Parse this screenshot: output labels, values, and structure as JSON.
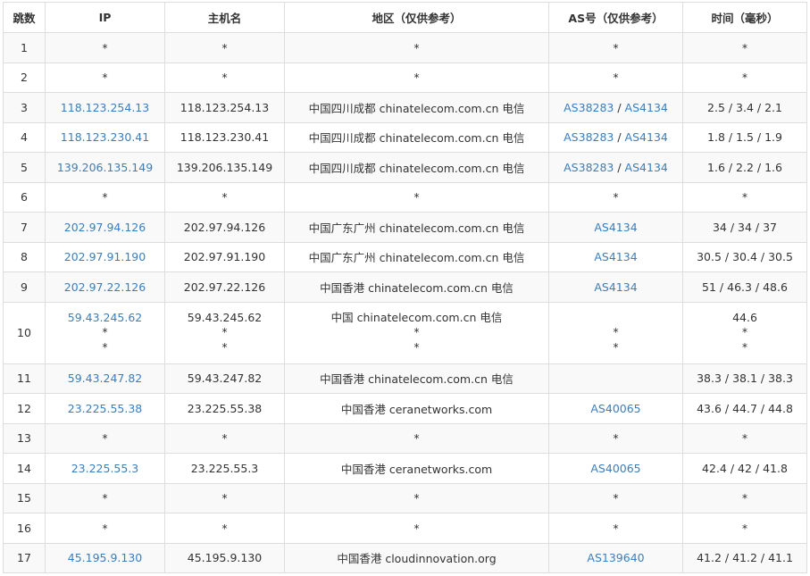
{
  "headers": [
    "跳数",
    "IP",
    "主机名",
    "地区（仅供参考）",
    "AS号（仅供参考）",
    "时间（毫秒）"
  ],
  "rows": [
    {
      "hop": "1",
      "ip": [
        "*"
      ],
      "host": [
        "*"
      ],
      "region": [
        "*"
      ],
      "as": [
        [
          "*"
        ]
      ],
      "time": [
        "*"
      ]
    },
    {
      "hop": "2",
      "ip": [
        "*"
      ],
      "host": [
        "*"
      ],
      "region": [
        "*"
      ],
      "as": [
        [
          "*"
        ]
      ],
      "time": [
        "*"
      ]
    },
    {
      "hop": "3",
      "ip": [
        "118.123.254.13"
      ],
      "host": [
        "118.123.254.13"
      ],
      "region": [
        "中国四川成都 chinatelecom.com.cn 电信"
      ],
      "as": [
        [
          "AS38283",
          "AS4134"
        ]
      ],
      "time": [
        "2.5 / 3.4 / 2.1"
      ]
    },
    {
      "hop": "4",
      "ip": [
        "118.123.230.41"
      ],
      "host": [
        "118.123.230.41"
      ],
      "region": [
        "中国四川成都 chinatelecom.com.cn 电信"
      ],
      "as": [
        [
          "AS38283",
          "AS4134"
        ]
      ],
      "time": [
        "1.8 / 1.5 / 1.9"
      ]
    },
    {
      "hop": "5",
      "ip": [
        "139.206.135.149"
      ],
      "host": [
        "139.206.135.149"
      ],
      "region": [
        "中国四川成都 chinatelecom.com.cn 电信"
      ],
      "as": [
        [
          "AS38283",
          "AS4134"
        ]
      ],
      "time": [
        "1.6 / 2.2 / 1.6"
      ]
    },
    {
      "hop": "6",
      "ip": [
        "*"
      ],
      "host": [
        "*"
      ],
      "region": [
        "*"
      ],
      "as": [
        [
          "*"
        ]
      ],
      "time": [
        "*"
      ]
    },
    {
      "hop": "7",
      "ip": [
        "202.97.94.126"
      ],
      "host": [
        "202.97.94.126"
      ],
      "region": [
        "中国广东广州 chinatelecom.com.cn 电信"
      ],
      "as": [
        [
          "AS4134"
        ]
      ],
      "time": [
        "34 / 34 / 37"
      ]
    },
    {
      "hop": "8",
      "ip": [
        "202.97.91.190"
      ],
      "host": [
        "202.97.91.190"
      ],
      "region": [
        "中国广东广州 chinatelecom.com.cn 电信"
      ],
      "as": [
        [
          "AS4134"
        ]
      ],
      "time": [
        "30.5 / 30.4 / 30.5"
      ]
    },
    {
      "hop": "9",
      "ip": [
        "202.97.22.126"
      ],
      "host": [
        "202.97.22.126"
      ],
      "region": [
        "中国香港 chinatelecom.com.cn 电信"
      ],
      "as": [
        [
          "AS4134"
        ]
      ],
      "time": [
        "51 / 46.3 / 48.6"
      ]
    },
    {
      "hop": "10",
      "ip": [
        "59.43.245.62",
        "*",
        "*"
      ],
      "host": [
        "59.43.245.62",
        "*",
        "*"
      ],
      "region": [
        "中国 chinatelecom.com.cn 电信",
        "*",
        "*"
      ],
      "as": [
        [
          ""
        ],
        [
          "*"
        ],
        [
          "*"
        ]
      ],
      "time": [
        "44.6",
        "*",
        "*"
      ]
    },
    {
      "hop": "11",
      "ip": [
        "59.43.247.82"
      ],
      "host": [
        "59.43.247.82"
      ],
      "region": [
        "中国香港 chinatelecom.com.cn 电信"
      ],
      "as": [
        [
          ""
        ]
      ],
      "time": [
        "38.3 / 38.1 / 38.3"
      ]
    },
    {
      "hop": "12",
      "ip": [
        "23.225.55.38"
      ],
      "host": [
        "23.225.55.38"
      ],
      "region": [
        "中国香港 ceranetworks.com"
      ],
      "as": [
        [
          "AS40065"
        ]
      ],
      "time": [
        "43.6 / 44.7 / 44.8"
      ]
    },
    {
      "hop": "13",
      "ip": [
        "*"
      ],
      "host": [
        "*"
      ],
      "region": [
        "*"
      ],
      "as": [
        [
          "*"
        ]
      ],
      "time": [
        "*"
      ]
    },
    {
      "hop": "14",
      "ip": [
        "23.225.55.3"
      ],
      "host": [
        "23.225.55.3"
      ],
      "region": [
        "中国香港 ceranetworks.com"
      ],
      "as": [
        [
          "AS40065"
        ]
      ],
      "time": [
        "42.4 / 42 / 41.8"
      ]
    },
    {
      "hop": "15",
      "ip": [
        "*"
      ],
      "host": [
        "*"
      ],
      "region": [
        "*"
      ],
      "as": [
        [
          "*"
        ]
      ],
      "time": [
        "*"
      ]
    },
    {
      "hop": "16",
      "ip": [
        "*"
      ],
      "host": [
        "*"
      ],
      "region": [
        "*"
      ],
      "as": [
        [
          "*"
        ]
      ],
      "time": [
        "*"
      ]
    },
    {
      "hop": "17",
      "ip": [
        "45.195.9.130"
      ],
      "host": [
        "45.195.9.130"
      ],
      "region": [
        "中国香港 cloudinnovation.org"
      ],
      "as": [
        [
          "AS139640"
        ]
      ],
      "time": [
        "41.2 / 41.2 / 41.1"
      ]
    }
  ],
  "colors": {
    "link": "#3a7ebf",
    "text": "#333333",
    "border": "#dddddd",
    "stripe": "#f9f9f9"
  }
}
